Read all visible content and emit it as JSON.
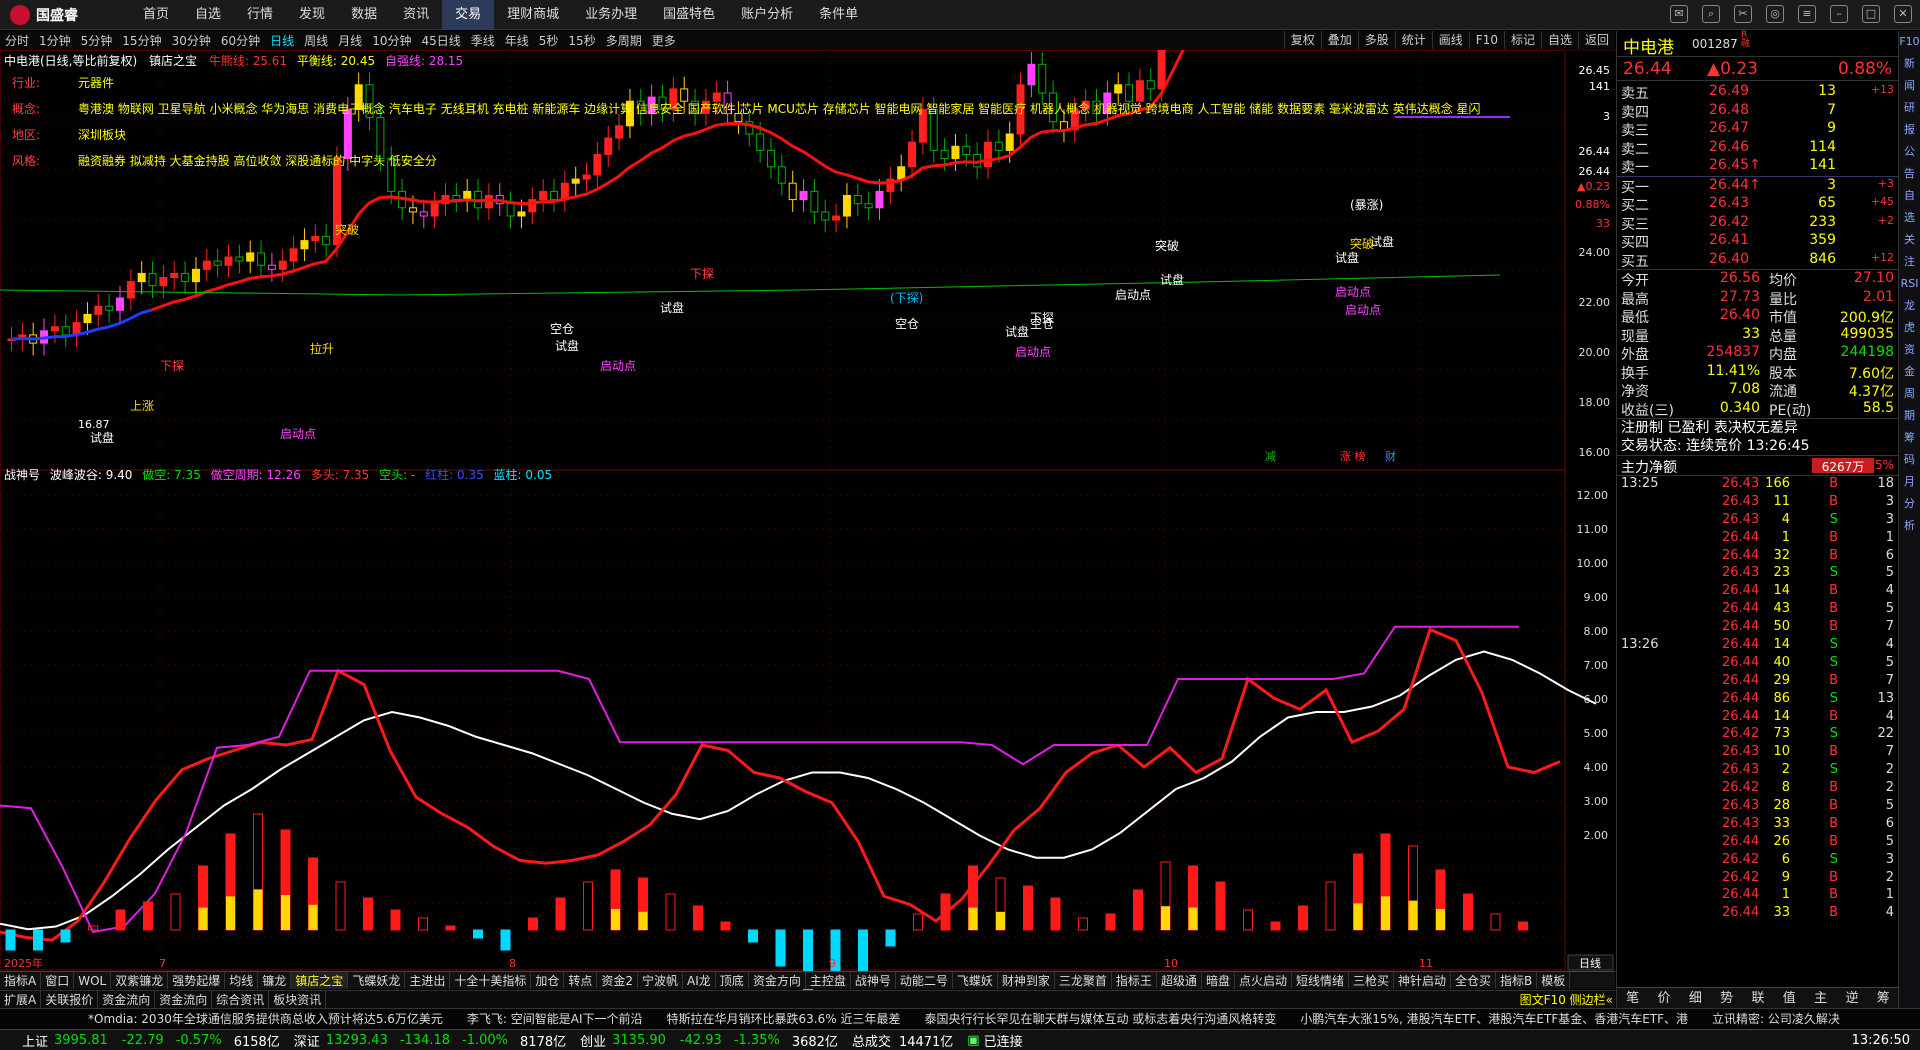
{
  "app": {
    "logo": "国盛睿"
  },
  "nav": [
    "首页",
    "自选",
    "行情",
    "发现",
    "数据",
    "资讯",
    "交易",
    "理财商城",
    "业务办理",
    "国盛特色",
    "账户分析",
    "条件单"
  ],
  "nav_active": 6,
  "periods": [
    "分时",
    "1分钟",
    "5分钟",
    "15分钟",
    "30分钟",
    "60分钟",
    "日线",
    "周线",
    "月线",
    "10分钟",
    "45日线",
    "季线",
    "年线",
    "5秒",
    "15秒",
    "多周期",
    "更多"
  ],
  "period_active": 6,
  "right_buttons": [
    "复权",
    "叠加",
    "多股",
    "统计",
    "画线",
    "F10",
    "标记",
    "自选",
    "返回"
  ],
  "kline_header": {
    "stock": "中电港(日线,等比前复权)",
    "indicator": "镇店之宝",
    "niu": "牛熊线: 25.61",
    "ping": "平衡线: 20.45",
    "zuqiang": "自强线: 28.15"
  },
  "stock_info": {
    "industry_label": "行业:",
    "industry": "元器件",
    "concept_label": "概念:",
    "concept": "粤港澳 物联网 卫星导航 小米概念 华为海思 消费电子概念 汽车电子 无线耳机 充电桩 新能源车 边缘计算 信息安全 国产软件 芯片 MCU芯片 存储芯片 智能电网 智能家居 智能医疗 机器人概念 机器视觉 跨境电商 人工智能 储能 数据要素 毫米波雷达 英伟达概念 星闪",
    "region_label": "地区:",
    "region": "深圳板块",
    "style_label": "风格:",
    "style": "融资融券 拟减持 大基金持股 高位收敛 深股通标的 中字头 低安全分"
  },
  "price_axis": [
    "26.45",
    "141",
    "3",
    "26.44",
    "26.44",
    "▲0.23",
    "0.88%",
    "33",
    "24.00",
    "22.00",
    "20.00",
    "18.00",
    "16.00"
  ],
  "osc_axis": [
    "12.00",
    "11.00",
    "10.00",
    "9.00",
    "8.00",
    "7.00",
    "6.00",
    "5.00",
    "4.00",
    "3.00",
    "2.00"
  ],
  "osc_header": {
    "name": "战神号",
    "bofeng": "波峰波谷: 9.40",
    "duokong": "做空: 7.35",
    "kongzhouqi": "做空周期: 12.26",
    "duotou": "多头: 7.35",
    "kongtou": "空头: -",
    "hongzhu": "红柱: 0.35",
    "lanzhu": "蓝柱: 0.05"
  },
  "date_labels": [
    "2025年",
    "7",
    "8",
    "9",
    "10",
    "11"
  ],
  "chart_markers": [
    "下探",
    "上涨",
    "试盘",
    "启动点",
    "拉升",
    "突破",
    "空仓",
    "试盘",
    "启动点",
    "下探",
    "试盘",
    "空仓",
    "(下探)",
    "试盘",
    "启动点",
    "空仓",
    "下探",
    "启动点",
    "突破",
    "试盘",
    "启动点",
    "试盘",
    "(暴涨)",
    "试盘",
    "启动点",
    "突破"
  ],
  "chart_price_labels": [
    "16.87"
  ],
  "chart_dialog_labels": [
    "减",
    "涨 榜",
    "财"
  ],
  "quote": {
    "name": "中电港",
    "code": "001287",
    "flags": "R\n融",
    "price": "26.44",
    "change": "▲0.23",
    "pct": "0.88%",
    "asks": [
      {
        "label": "卖五",
        "price": "26.49",
        "vol": "13",
        "chg": "+13"
      },
      {
        "label": "卖四",
        "price": "26.48",
        "vol": "7",
        "chg": ""
      },
      {
        "label": "卖三",
        "price": "26.47",
        "vol": "9",
        "chg": ""
      },
      {
        "label": "卖二",
        "price": "26.46",
        "vol": "114",
        "chg": ""
      },
      {
        "label": "卖一",
        "price": "26.45↑",
        "vol": "141",
        "chg": ""
      }
    ],
    "bids": [
      {
        "label": "买一",
        "price": "26.44↑",
        "vol": "3",
        "chg": "+3"
      },
      {
        "label": "买二",
        "price": "26.43",
        "vol": "65",
        "chg": "+45"
      },
      {
        "label": "买三",
        "price": "26.42",
        "vol": "233",
        "chg": "+2"
      },
      {
        "label": "买四",
        "price": "26.41",
        "vol": "359",
        "chg": ""
      },
      {
        "label": "买五",
        "price": "26.40",
        "vol": "846",
        "chg": "+12"
      }
    ],
    "stats": [
      [
        "今开",
        "26.56",
        "均价",
        "27.10"
      ],
      [
        "最高",
        "27.73",
        "量比",
        "2.01"
      ],
      [
        "最低",
        "26.40",
        "市值",
        "200.9亿"
      ],
      [
        "现量",
        "33",
        "总量",
        "499035"
      ],
      [
        "外盘",
        "254837",
        "内盘",
        "244198"
      ],
      [
        "换手",
        "11.41%",
        "股本",
        "7.60亿"
      ],
      [
        "净资",
        "7.08",
        "流通",
        "4.37亿"
      ],
      [
        "收益(三)",
        "0.340",
        "PE(动)",
        "58.5"
      ]
    ],
    "register": "注册制 已盈利 表决权无差异",
    "trade_status": "交易状态: 连续竞价 13:26:45",
    "main_flow_label": "主力净额",
    "main_flow": "6267万",
    "main_flow_pct": "5%",
    "ticks": [
      [
        "13:25",
        "26.43",
        "166",
        "B",
        "18"
      ],
      [
        "",
        "26.43",
        "11",
        "B",
        "3"
      ],
      [
        "",
        "26.43",
        "4",
        "S",
        "3"
      ],
      [
        "",
        "26.44",
        "1",
        "B",
        "1"
      ],
      [
        "",
        "26.44",
        "32",
        "B",
        "6"
      ],
      [
        "",
        "26.43",
        "23",
        "S",
        "5"
      ],
      [
        "",
        "26.44",
        "14",
        "B",
        "4"
      ],
      [
        "",
        "26.44",
        "43",
        "B",
        "5"
      ],
      [
        "",
        "26.44",
        "50",
        "B",
        "7"
      ],
      [
        "13:26",
        "26.44",
        "14",
        "S",
        "4"
      ],
      [
        "",
        "26.44",
        "40",
        "S",
        "5"
      ],
      [
        "",
        "26.44",
        "29",
        "B",
        "7"
      ],
      [
        "",
        "26.44",
        "86",
        "S",
        "13"
      ],
      [
        "",
        "26.44",
        "14",
        "B",
        "4"
      ],
      [
        "",
        "26.42",
        "73",
        "S",
        "22"
      ],
      [
        "",
        "26.43",
        "10",
        "B",
        "7"
      ],
      [
        "",
        "26.43",
        "2",
        "S",
        "2"
      ],
      [
        "",
        "26.42",
        "8",
        "B",
        "2"
      ],
      [
        "",
        "26.43",
        "28",
        "B",
        "5"
      ],
      [
        "",
        "26.43",
        "33",
        "B",
        "6"
      ],
      [
        "",
        "26.44",
        "26",
        "B",
        "5"
      ],
      [
        "",
        "26.42",
        "6",
        "S",
        "3"
      ],
      [
        "",
        "26.42",
        "9",
        "B",
        "2"
      ],
      [
        "",
        "26.44",
        "1",
        "B",
        "1"
      ],
      [
        "",
        "26.44",
        "33",
        "B",
        "4"
      ]
    ],
    "bottom_tabs": [
      "笔",
      "价",
      "细",
      "势",
      "联",
      "值",
      "主",
      "逆",
      "筹"
    ]
  },
  "side_tabs": [
    "F10",
    "新闻",
    "研报",
    "公告",
    "自选",
    "关注",
    "RSI",
    "龙虎",
    "资金",
    "周期",
    "筹码",
    "月",
    "分析"
  ],
  "bottom_tabs": [
    "指标A",
    "窗口",
    "WOL",
    "双紫镰龙",
    "强势起爆",
    "均线",
    "镰龙",
    "镇店之宝",
    "飞蝶妖龙",
    "主进出",
    "十全十美指标",
    "加仓",
    "转点",
    "资金2",
    "宁波帆",
    "AI龙",
    "顶底",
    "资金方向",
    "主控盘",
    "战神号",
    "动能二号",
    "飞蝶妖",
    "财神到家",
    "三龙聚首",
    "指标王",
    "超级通",
    "暗盘",
    "点火启动",
    "短线情绪",
    "三枪买",
    "神针启动",
    "全仓买",
    "指标B",
    "模板"
  ],
  "bottom_tabs_active": 7,
  "bottom_tabs2": [
    "扩展A",
    "关联报价",
    "资金流向",
    "资金流向",
    "综合资讯",
    "板块资讯"
  ],
  "bottom_right": "图文F10 侧边栏«",
  "news": [
    "*Omdia: 2030年全球通信服务提供商总收入预计将达5.6万亿美元",
    "李飞飞: 空间智能是AI下一个前沿",
    "特斯拉在华月销环比暴跌63.6% 近三年最差",
    "泰国央行行长罕见在聊天群与媒体互动 或标志着央行沟通风格转变",
    "小鹏汽车大涨15%, 港股汽车ETF、港股汽车ETF基金、香港汽车ETF、港",
    "立讯精密: 公司凌久解决"
  ],
  "status": {
    "sh_label": "上证",
    "sh": "3995.81",
    "sh_chg": "-22.79",
    "sh_pct": "-0.57%",
    "sh_vol": "6158亿",
    "sz_label": "深证",
    "sz": "13293.43",
    "sz_chg": "-134.18",
    "sz_pct": "-1.00%",
    "sz_vol": "8178亿",
    "cy_label": "创业",
    "cy": "3135.90",
    "cy_chg": "-42.93",
    "cy_pct": "-1.35%",
    "cy_vol": "3682亿",
    "total_label": "总成交",
    "total": "14471亿",
    "conn": "已连接",
    "time": "13:26:50"
  },
  "colors": {
    "up": "#ff3232",
    "down": "#00e000",
    "bg": "#000000",
    "accent": "#2d3b5a"
  }
}
